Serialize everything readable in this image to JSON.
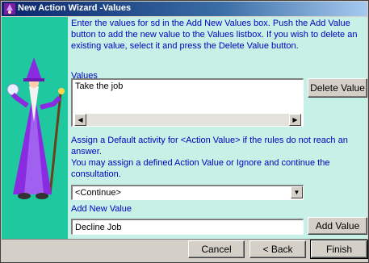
{
  "window": {
    "title": "New Action Wizard -Values"
  },
  "instructions": "Enter the values for sd in the Add New Values box. Push the Add Value button to add the new value to the Values listbox. If you wish to delete an existing value, select it and press the Delete Value button.",
  "values": {
    "label": "Values",
    "items": [
      "Take the job"
    ],
    "delete_label": "Delete Value"
  },
  "assign": {
    "line1": "Assign a Default activity for <Action Value> if the rules do not reach an answer.",
    "line2": "You may assign a defined Action Value or Ignore and continue the consultation.",
    "selected": "<Continue>"
  },
  "add_new": {
    "label": "Add New Value",
    "value": "Decline Job",
    "add_label": "Add Value"
  },
  "footer": {
    "cancel_label": "Cancel",
    "back_label": "< Back",
    "finish_label": "Finish"
  },
  "icons": {
    "app": "wizard-app-icon",
    "illustration": "wizard-illustration",
    "scroll_left": "scroll-left-icon",
    "scroll_right": "scroll-right-icon",
    "dropdown": "chevron-down-icon"
  },
  "colors": {
    "instruction_text": "#0000c0",
    "panel_bg": "#c7f1e6",
    "sidebar_bg": "#20c8a0",
    "titlebar": "#0a246a"
  }
}
